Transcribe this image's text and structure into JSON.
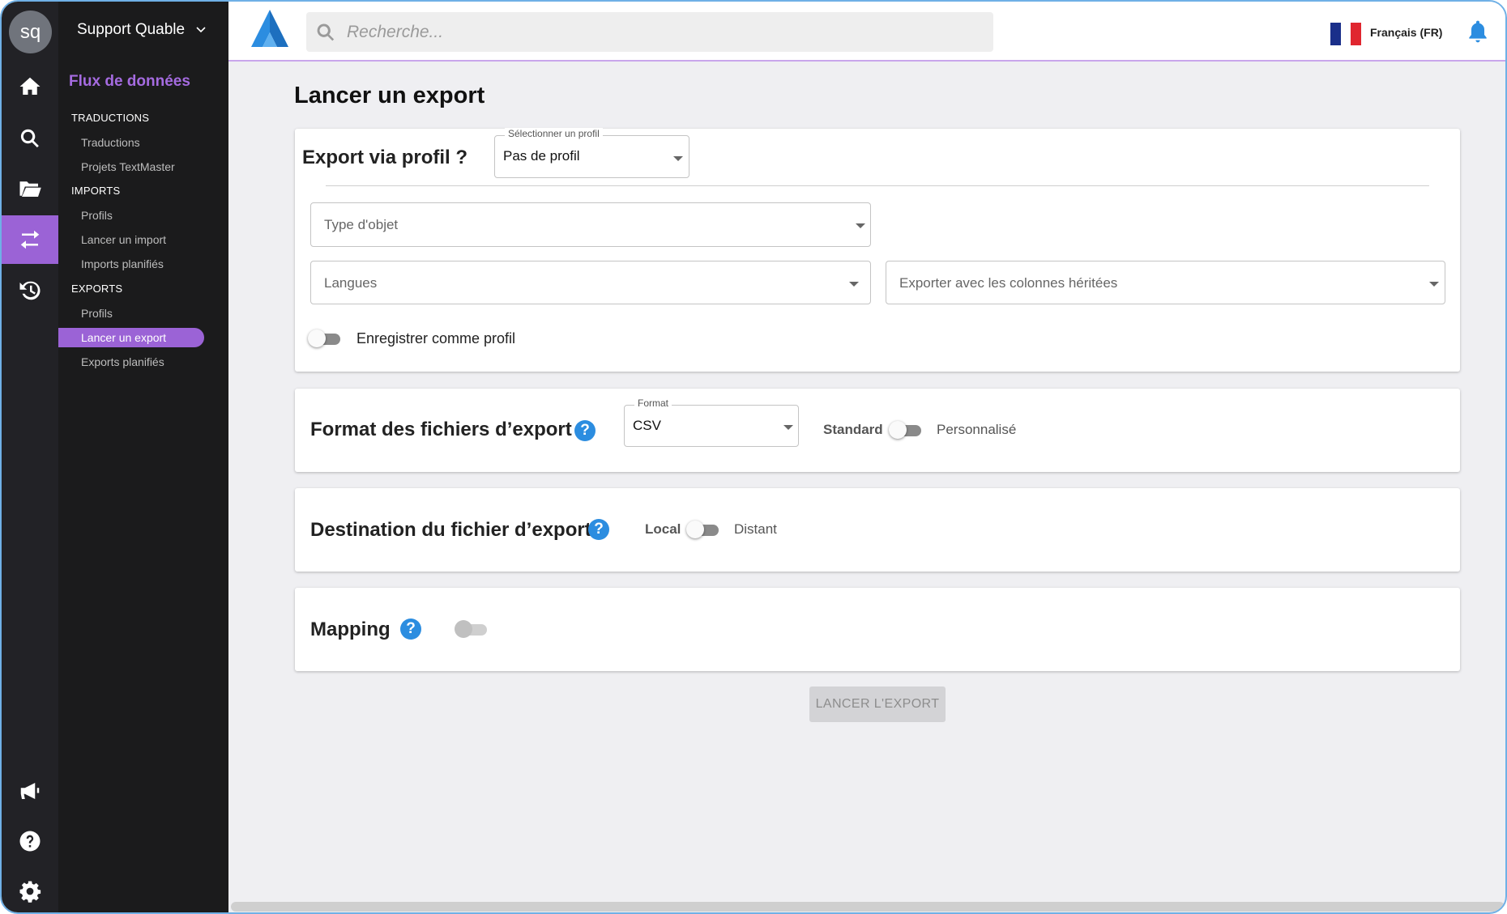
{
  "user": {
    "initials": "sq",
    "org": "Support Quable"
  },
  "rail": {
    "items": [
      "home-icon",
      "search-icon",
      "folder-open-icon",
      "transfer-icon",
      "history-icon"
    ],
    "bottom": [
      "megaphone-icon",
      "help-circle-icon",
      "gear-icon"
    ]
  },
  "submenu": {
    "title": "Flux de données",
    "sections": [
      {
        "label": "TRADUCTIONS",
        "items": [
          "Traductions",
          "Projets TextMaster"
        ]
      },
      {
        "label": "IMPORTS",
        "items": [
          "Profils",
          "Lancer un import",
          "Imports planifiés"
        ]
      },
      {
        "label": "EXPORTS",
        "items": [
          "Profils",
          "Lancer un export",
          "Exports planifiés"
        ]
      }
    ],
    "active": "Lancer un export"
  },
  "topbar": {
    "search_placeholder": "Recherche...",
    "language": "Français (FR)"
  },
  "colors": {
    "accent": "#9b63d6",
    "help": "#2c8de0",
    "sidebar": "#1b1b1c"
  },
  "page": {
    "title": "Lancer un export",
    "profile": {
      "heading": "Export via profil ?",
      "select_label": "Sélectionner un profil",
      "select_value": "Pas de profil"
    },
    "object_type_placeholder": "Type d'objet",
    "languages_placeholder": "Langues",
    "inherited_placeholder": "Exporter avec les colonnes héritées",
    "save_profile_label": "Enregistrer comme profil",
    "format": {
      "heading": "Format des fichiers d’export :",
      "select_label": "Format",
      "select_value": "CSV",
      "left": "Standard",
      "right": "Personnalisé"
    },
    "destination": {
      "heading": "Destination du fichier d’export",
      "left": "Local",
      "right": "Distant"
    },
    "mapping": {
      "heading": "Mapping"
    },
    "launch_button": "LANCER L'EXPORT"
  }
}
